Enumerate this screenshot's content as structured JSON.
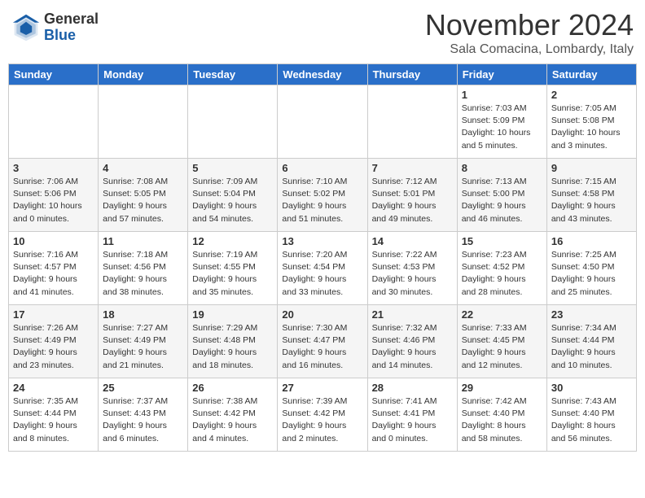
{
  "header": {
    "logo_general": "General",
    "logo_blue": "Blue",
    "month_title": "November 2024",
    "location": "Sala Comacina, Lombardy, Italy"
  },
  "weekdays": [
    "Sunday",
    "Monday",
    "Tuesday",
    "Wednesday",
    "Thursday",
    "Friday",
    "Saturday"
  ],
  "weeks": [
    [
      {
        "day": "",
        "info": ""
      },
      {
        "day": "",
        "info": ""
      },
      {
        "day": "",
        "info": ""
      },
      {
        "day": "",
        "info": ""
      },
      {
        "day": "",
        "info": ""
      },
      {
        "day": "1",
        "info": "Sunrise: 7:03 AM\nSunset: 5:09 PM\nDaylight: 10 hours\nand 5 minutes."
      },
      {
        "day": "2",
        "info": "Sunrise: 7:05 AM\nSunset: 5:08 PM\nDaylight: 10 hours\nand 3 minutes."
      }
    ],
    [
      {
        "day": "3",
        "info": "Sunrise: 7:06 AM\nSunset: 5:06 PM\nDaylight: 10 hours\nand 0 minutes."
      },
      {
        "day": "4",
        "info": "Sunrise: 7:08 AM\nSunset: 5:05 PM\nDaylight: 9 hours\nand 57 minutes."
      },
      {
        "day": "5",
        "info": "Sunrise: 7:09 AM\nSunset: 5:04 PM\nDaylight: 9 hours\nand 54 minutes."
      },
      {
        "day": "6",
        "info": "Sunrise: 7:10 AM\nSunset: 5:02 PM\nDaylight: 9 hours\nand 51 minutes."
      },
      {
        "day": "7",
        "info": "Sunrise: 7:12 AM\nSunset: 5:01 PM\nDaylight: 9 hours\nand 49 minutes."
      },
      {
        "day": "8",
        "info": "Sunrise: 7:13 AM\nSunset: 5:00 PM\nDaylight: 9 hours\nand 46 minutes."
      },
      {
        "day": "9",
        "info": "Sunrise: 7:15 AM\nSunset: 4:58 PM\nDaylight: 9 hours\nand 43 minutes."
      }
    ],
    [
      {
        "day": "10",
        "info": "Sunrise: 7:16 AM\nSunset: 4:57 PM\nDaylight: 9 hours\nand 41 minutes."
      },
      {
        "day": "11",
        "info": "Sunrise: 7:18 AM\nSunset: 4:56 PM\nDaylight: 9 hours\nand 38 minutes."
      },
      {
        "day": "12",
        "info": "Sunrise: 7:19 AM\nSunset: 4:55 PM\nDaylight: 9 hours\nand 35 minutes."
      },
      {
        "day": "13",
        "info": "Sunrise: 7:20 AM\nSunset: 4:54 PM\nDaylight: 9 hours\nand 33 minutes."
      },
      {
        "day": "14",
        "info": "Sunrise: 7:22 AM\nSunset: 4:53 PM\nDaylight: 9 hours\nand 30 minutes."
      },
      {
        "day": "15",
        "info": "Sunrise: 7:23 AM\nSunset: 4:52 PM\nDaylight: 9 hours\nand 28 minutes."
      },
      {
        "day": "16",
        "info": "Sunrise: 7:25 AM\nSunset: 4:50 PM\nDaylight: 9 hours\nand 25 minutes."
      }
    ],
    [
      {
        "day": "17",
        "info": "Sunrise: 7:26 AM\nSunset: 4:49 PM\nDaylight: 9 hours\nand 23 minutes."
      },
      {
        "day": "18",
        "info": "Sunrise: 7:27 AM\nSunset: 4:49 PM\nDaylight: 9 hours\nand 21 minutes."
      },
      {
        "day": "19",
        "info": "Sunrise: 7:29 AM\nSunset: 4:48 PM\nDaylight: 9 hours\nand 18 minutes."
      },
      {
        "day": "20",
        "info": "Sunrise: 7:30 AM\nSunset: 4:47 PM\nDaylight: 9 hours\nand 16 minutes."
      },
      {
        "day": "21",
        "info": "Sunrise: 7:32 AM\nSunset: 4:46 PM\nDaylight: 9 hours\nand 14 minutes."
      },
      {
        "day": "22",
        "info": "Sunrise: 7:33 AM\nSunset: 4:45 PM\nDaylight: 9 hours\nand 12 minutes."
      },
      {
        "day": "23",
        "info": "Sunrise: 7:34 AM\nSunset: 4:44 PM\nDaylight: 9 hours\nand 10 minutes."
      }
    ],
    [
      {
        "day": "24",
        "info": "Sunrise: 7:35 AM\nSunset: 4:44 PM\nDaylight: 9 hours\nand 8 minutes."
      },
      {
        "day": "25",
        "info": "Sunrise: 7:37 AM\nSunset: 4:43 PM\nDaylight: 9 hours\nand 6 minutes."
      },
      {
        "day": "26",
        "info": "Sunrise: 7:38 AM\nSunset: 4:42 PM\nDaylight: 9 hours\nand 4 minutes."
      },
      {
        "day": "27",
        "info": "Sunrise: 7:39 AM\nSunset: 4:42 PM\nDaylight: 9 hours\nand 2 minutes."
      },
      {
        "day": "28",
        "info": "Sunrise: 7:41 AM\nSunset: 4:41 PM\nDaylight: 9 hours\nand 0 minutes."
      },
      {
        "day": "29",
        "info": "Sunrise: 7:42 AM\nSunset: 4:40 PM\nDaylight: 8 hours\nand 58 minutes."
      },
      {
        "day": "30",
        "info": "Sunrise: 7:43 AM\nSunset: 4:40 PM\nDaylight: 8 hours\nand 56 minutes."
      }
    ]
  ]
}
